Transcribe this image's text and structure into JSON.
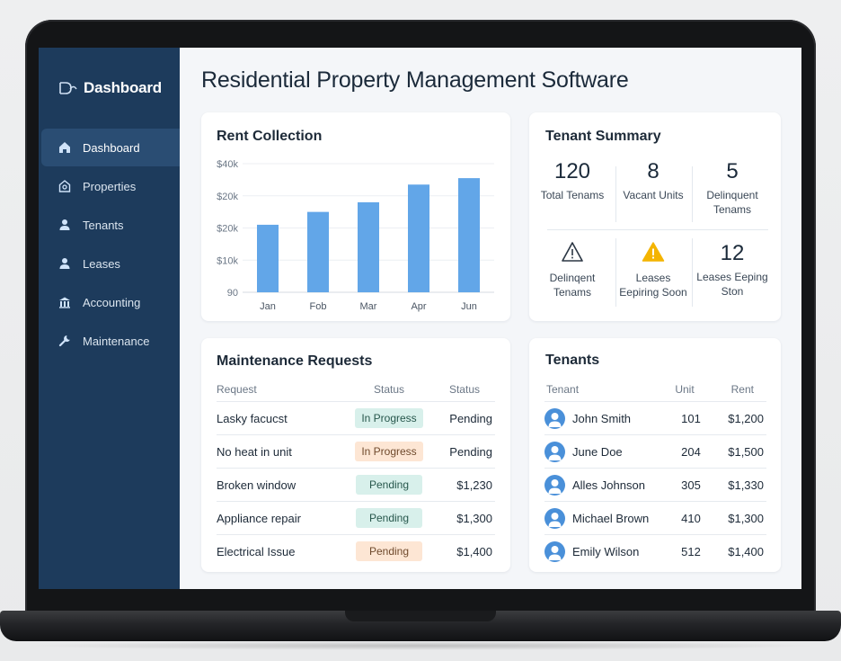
{
  "sidebar": {
    "brand": "Dashboard",
    "items": [
      {
        "label": "Dashboard",
        "icon": "home-icon",
        "active": true
      },
      {
        "label": "Properties",
        "icon": "property-icon"
      },
      {
        "label": "Tenants",
        "icon": "user-icon"
      },
      {
        "label": "Leases",
        "icon": "user-icon"
      },
      {
        "label": "Accounting",
        "icon": "bank-icon"
      },
      {
        "label": "Maintenance",
        "icon": "wrench-icon"
      }
    ]
  },
  "main": {
    "title": "Residential Property Management Software"
  },
  "rent_collection": {
    "title": "Rent Collection",
    "bar_color": "#62a6e8"
  },
  "chart_data": {
    "type": "bar",
    "title": "Rent Collection",
    "categories": [
      "Jan",
      "Fob",
      "Mar",
      "Apr",
      "Jun"
    ],
    "values": [
      21,
      25,
      28,
      33.5,
      35.5
    ],
    "ytick_labels": [
      "90",
      "$10k",
      "$20k",
      "$20k",
      "$40k"
    ],
    "ylim": [
      0,
      40
    ],
    "xlabel": "",
    "ylabel": "",
    "grid": true
  },
  "tenant_summary": {
    "title": "Tenant Summary",
    "stats": [
      {
        "value": "120",
        "label": "Total Tenams"
      },
      {
        "value": "8",
        "label": "Vacant Units"
      },
      {
        "value": "5",
        "label": "Delinquent Tenams"
      }
    ],
    "alerts": [
      {
        "icon": "warning-outline-icon",
        "label": "Delinqent Tenams"
      },
      {
        "icon": "warning-filled-icon",
        "label": "Leases Eepiring Soon",
        "color": "#f4b400"
      },
      {
        "value": "12",
        "label": "Leases Eeping Ston"
      }
    ]
  },
  "maintenance": {
    "title": "Maintenance Requests",
    "columns": [
      "Request",
      "Status",
      "Status"
    ],
    "rows": [
      {
        "request": "Lasky facucst",
        "status": "In Progress",
        "status_color": "green",
        "value": "Pending"
      },
      {
        "request": "No heat in unit",
        "status": "In Progress",
        "status_color": "peach",
        "value": "Pending"
      },
      {
        "request": "Broken window",
        "status": "Pending",
        "status_color": "green",
        "value": "$1,230"
      },
      {
        "request": "Appliance repair",
        "status": "Pending",
        "status_color": "green",
        "value": "$1,300"
      },
      {
        "request": "Electrical Issue",
        "status": "Pending",
        "status_color": "peach",
        "value": "$1,400"
      }
    ]
  },
  "tenants": {
    "title": "Tenants",
    "columns": [
      "Tenant",
      "Unit",
      "Rent"
    ],
    "rows": [
      {
        "name": "John Smith",
        "unit": "101",
        "rent": "$1,200"
      },
      {
        "name": "June Doe",
        "unit": "204",
        "rent": "$1,500"
      },
      {
        "name": "Alles Johnson",
        "unit": "305",
        "rent": "$1,330"
      },
      {
        "name": "Michael Brown",
        "unit": "410",
        "rent": "$1,300"
      },
      {
        "name": "Emily Wilson",
        "unit": "512",
        "rent": "$1,400"
      }
    ]
  },
  "colors": {
    "sidebar_bg": "#1d3b5c",
    "sidebar_active": "#2a4d73",
    "avatar": "#4a90d9",
    "pill_green": "#d8f0eb",
    "pill_peach": "#fde6d4"
  }
}
